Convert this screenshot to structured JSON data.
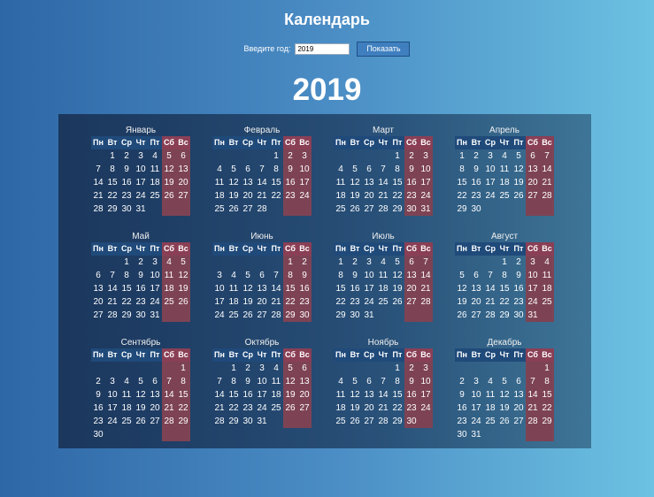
{
  "header": {
    "title": "Календарь"
  },
  "form": {
    "label": "Введите год:",
    "year_value": "2019",
    "submit_label": "Показать"
  },
  "year_heading": "2019",
  "weekdays": [
    "Пн",
    "Вт",
    "Ср",
    "Чт",
    "Пт",
    "Сб",
    "Вс"
  ],
  "colors": {
    "weekend_bg": "#7d4354",
    "weekday_header_bg": "#1f4a7a"
  },
  "months": [
    {
      "name": "Январь",
      "start": 1,
      "days": 31
    },
    {
      "name": "Февраль",
      "start": 4,
      "days": 28
    },
    {
      "name": "Март",
      "start": 4,
      "days": 31
    },
    {
      "name": "Апрель",
      "start": 0,
      "days": 30
    },
    {
      "name": "Май",
      "start": 2,
      "days": 31
    },
    {
      "name": "Июнь",
      "start": 5,
      "days": 30
    },
    {
      "name": "Июль",
      "start": 0,
      "days": 31
    },
    {
      "name": "Август",
      "start": 3,
      "days": 31
    },
    {
      "name": "Сентябрь",
      "start": 6,
      "days": 30
    },
    {
      "name": "Октябрь",
      "start": 1,
      "days": 31
    },
    {
      "name": "Ноябрь",
      "start": 4,
      "days": 30
    },
    {
      "name": "Декабрь",
      "start": 6,
      "days": 31
    }
  ]
}
